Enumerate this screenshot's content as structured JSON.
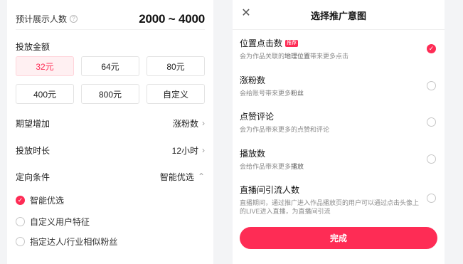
{
  "left": {
    "estimate_label": "预计展示人数",
    "estimate_value": "2000 ~ 4000",
    "amount_title": "投放金额",
    "amounts": [
      "32元",
      "64元",
      "80元",
      "400元",
      "800元",
      "自定义"
    ],
    "selected_amount": "32元",
    "expect_label": "期望增加",
    "expect_value": "涨粉数",
    "duration_label": "投放时长",
    "duration_value": "12小时",
    "target_label": "定向条件",
    "target_value": "智能优选",
    "options": [
      {
        "label": "智能优选",
        "checked": true
      },
      {
        "label": "自定义用户特征",
        "checked": false
      },
      {
        "label": "指定达人/行业相似粉丝",
        "checked": false
      }
    ]
  },
  "right": {
    "title": "选择推广意图",
    "badge": "推荐",
    "items": [
      {
        "title": "位置点击数",
        "desc_pre": "会为作品关联的",
        "desc_em": "地理位置",
        "desc_post": "带来更多点击",
        "checked": true
      },
      {
        "title": "涨粉数",
        "desc_pre": "会给账号带来更多",
        "desc_em": "粉丝",
        "desc_post": "",
        "checked": false
      },
      {
        "title": "点赞评论",
        "desc_pre": "会为作品带来更多的点赞和评论",
        "desc_em": "",
        "desc_post": "",
        "checked": false
      },
      {
        "title": "播放数",
        "desc_pre": "会给作品带来更多",
        "desc_em": "播放",
        "desc_post": "",
        "checked": false
      },
      {
        "title": "直播间引流人数",
        "desc_pre": "直播期间，通过推广进入作品播放页的用户可以通过点击头像上的LIVE进入直播，为直播间引流",
        "desc_em": "",
        "desc_post": "",
        "checked": false
      }
    ],
    "done_label": "完成"
  },
  "colors": {
    "accent": "#fe2c55",
    "accent_light": "#fff0f2"
  }
}
